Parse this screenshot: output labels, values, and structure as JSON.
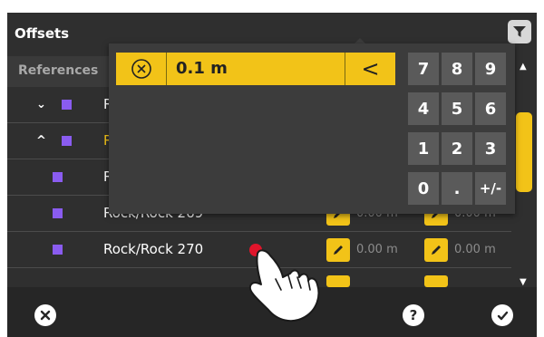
{
  "header": {
    "title": "Offsets",
    "filter_icon": "filter-icon"
  },
  "references": {
    "label": "References"
  },
  "rows": [
    {
      "label": "R",
      "chevron": "⌄",
      "active": false
    },
    {
      "label": "R",
      "chevron": "^",
      "active": true
    },
    {
      "label": "R"
    },
    {
      "label": "Rock/Rock 269",
      "val1": "0.00 m",
      "val2": "0.00 m"
    },
    {
      "label": "Rock/Rock 270",
      "val1": "0.00 m",
      "val2": "0.00 m"
    }
  ],
  "keypad": {
    "value": "0.1 m",
    "backspace": "<",
    "keys": [
      "7",
      "8",
      "9",
      "4",
      "5",
      "6",
      "1",
      "2",
      "3",
      "0",
      ".",
      "+/-"
    ]
  },
  "bottom": {
    "help": "?"
  },
  "colors": {
    "accent": "#f2c318",
    "swatch": "#8a5cf0",
    "background": "#2f2f2f"
  }
}
